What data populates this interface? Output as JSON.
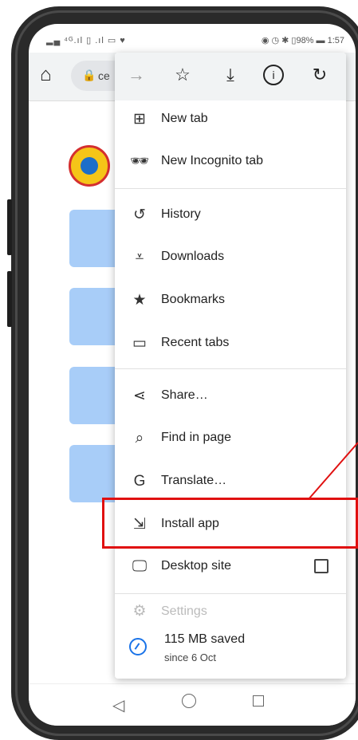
{
  "status_bar": {
    "left_text": "▂▄ ⁴ᴳ.ıl ▯ .ıl ▭ ♥",
    "right_text": "◉ ◷ ✱ ▯98% ▬ 1:57"
  },
  "url_bar": {
    "url": "ce"
  },
  "menu": {
    "items": [
      {
        "label": "New tab",
        "icon": "plus-box-icon"
      },
      {
        "label": "New Incognito tab",
        "icon": "incognito-icon"
      },
      {
        "label": "History",
        "icon": "history-icon"
      },
      {
        "label": "Downloads",
        "icon": "download-check-icon"
      },
      {
        "label": "Bookmarks",
        "icon": "star-icon"
      },
      {
        "label": "Recent tabs",
        "icon": "devices-icon"
      },
      {
        "label": "Share…",
        "icon": "share-icon"
      },
      {
        "label": "Find in page",
        "icon": "find-icon"
      },
      {
        "label": "Translate…",
        "icon": "translate-icon"
      },
      {
        "label": "Install app",
        "icon": "install-app-icon"
      },
      {
        "label": "Desktop site",
        "icon": "desktop-icon"
      },
      {
        "label": "Settings",
        "icon": "gear-icon"
      }
    ],
    "desktop_site_checked": false,
    "saved": {
      "title": "115 MB saved",
      "subtitle": "since 6 Oct"
    }
  },
  "colors": {
    "highlight": "#e01010",
    "accent": "#1a73e8",
    "tile": "#a8cdf8"
  }
}
